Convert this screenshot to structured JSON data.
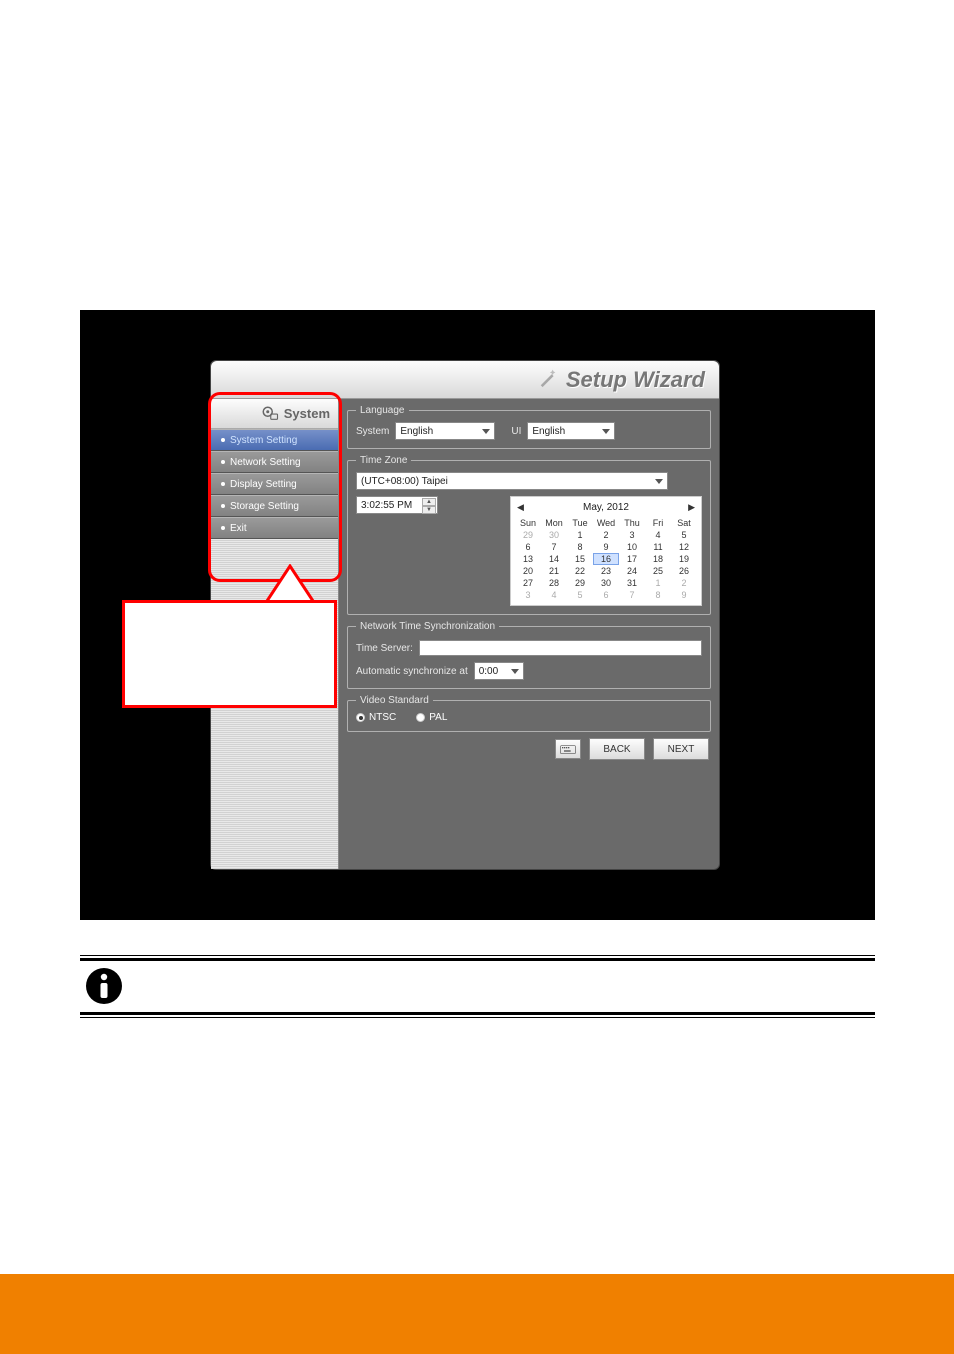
{
  "window": {
    "title": "Setup Wizard"
  },
  "sidebar": {
    "header": "System",
    "items": [
      {
        "label": "System Setting",
        "selected": true
      },
      {
        "label": "Network Setting",
        "selected": false
      },
      {
        "label": "Display Setting",
        "selected": false
      },
      {
        "label": "Storage Setting",
        "selected": false
      },
      {
        "label": "Exit",
        "selected": false
      }
    ]
  },
  "language": {
    "legend": "Language",
    "system_label": "System",
    "system_value": "English",
    "ui_label": "UI",
    "ui_value": "English"
  },
  "timezone": {
    "legend": "Time Zone",
    "value": "(UTC+08:00) Taipei",
    "time_value": "3:02:55 PM"
  },
  "calendar": {
    "title": "May, 2012",
    "dow": [
      "Sun",
      "Mon",
      "Tue",
      "Wed",
      "Thu",
      "Fri",
      "Sat"
    ],
    "weeks": [
      [
        {
          "d": "29",
          "dim": true
        },
        {
          "d": "30",
          "dim": true
        },
        {
          "d": "1"
        },
        {
          "d": "2"
        },
        {
          "d": "3"
        },
        {
          "d": "4"
        },
        {
          "d": "5"
        }
      ],
      [
        {
          "d": "6"
        },
        {
          "d": "7"
        },
        {
          "d": "8"
        },
        {
          "d": "9"
        },
        {
          "d": "10"
        },
        {
          "d": "11"
        },
        {
          "d": "12"
        }
      ],
      [
        {
          "d": "13"
        },
        {
          "d": "14"
        },
        {
          "d": "15"
        },
        {
          "d": "16",
          "sel": true
        },
        {
          "d": "17"
        },
        {
          "d": "18"
        },
        {
          "d": "19"
        }
      ],
      [
        {
          "d": "20"
        },
        {
          "d": "21"
        },
        {
          "d": "22"
        },
        {
          "d": "23"
        },
        {
          "d": "24"
        },
        {
          "d": "25"
        },
        {
          "d": "26"
        }
      ],
      [
        {
          "d": "27"
        },
        {
          "d": "28"
        },
        {
          "d": "29"
        },
        {
          "d": "30"
        },
        {
          "d": "31"
        },
        {
          "d": "1",
          "dim": true
        },
        {
          "d": "2",
          "dim": true
        }
      ],
      [
        {
          "d": "3",
          "dim": true
        },
        {
          "d": "4",
          "dim": true
        },
        {
          "d": "5",
          "dim": true
        },
        {
          "d": "6",
          "dim": true
        },
        {
          "d": "7",
          "dim": true
        },
        {
          "d": "8",
          "dim": true
        },
        {
          "d": "9",
          "dim": true
        }
      ]
    ]
  },
  "nts": {
    "legend": "Network Time Synchronization",
    "server_label": "Time Server:",
    "sync_label": "Automatic synchronize at",
    "sync_value": "0:00"
  },
  "video": {
    "legend": "Video Standard",
    "ntsc": "NTSC",
    "pal": "PAL",
    "selected": "NTSC"
  },
  "buttons": {
    "back": "BACK",
    "next": "NEXT"
  }
}
